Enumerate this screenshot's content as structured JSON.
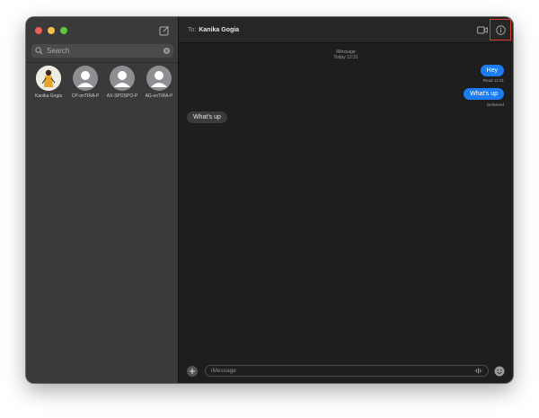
{
  "sidebar": {
    "search": {
      "placeholder": "Search"
    },
    "pinned": [
      {
        "name": "Kanika Gogia",
        "avatar": "photo"
      },
      {
        "name": "CP-onTIRA-P",
        "avatar": "default-person"
      },
      {
        "name": "AX-SPOSPO-P",
        "avatar": "default-person"
      },
      {
        "name": "AG-onTIRA-P",
        "avatar": "default-person"
      }
    ]
  },
  "header": {
    "to_label": "To:",
    "recipient": "Kanika Gogia"
  },
  "conversation": {
    "service": "iMessage",
    "timestamp": "Today 12:31",
    "messages": [
      {
        "direction": "sent",
        "text": "Hey",
        "status": "Read 12:31"
      },
      {
        "direction": "sent",
        "text": "What's up",
        "status": "Delivered"
      },
      {
        "direction": "received",
        "text": "What's up"
      }
    ]
  },
  "composer": {
    "placeholder": "iMessage"
  },
  "colors": {
    "accent": "#1e7cf2",
    "highlight": "#d83a2e",
    "close": "#ed5f56",
    "minimize": "#f4bd4f",
    "zoom": "#5ec541"
  }
}
